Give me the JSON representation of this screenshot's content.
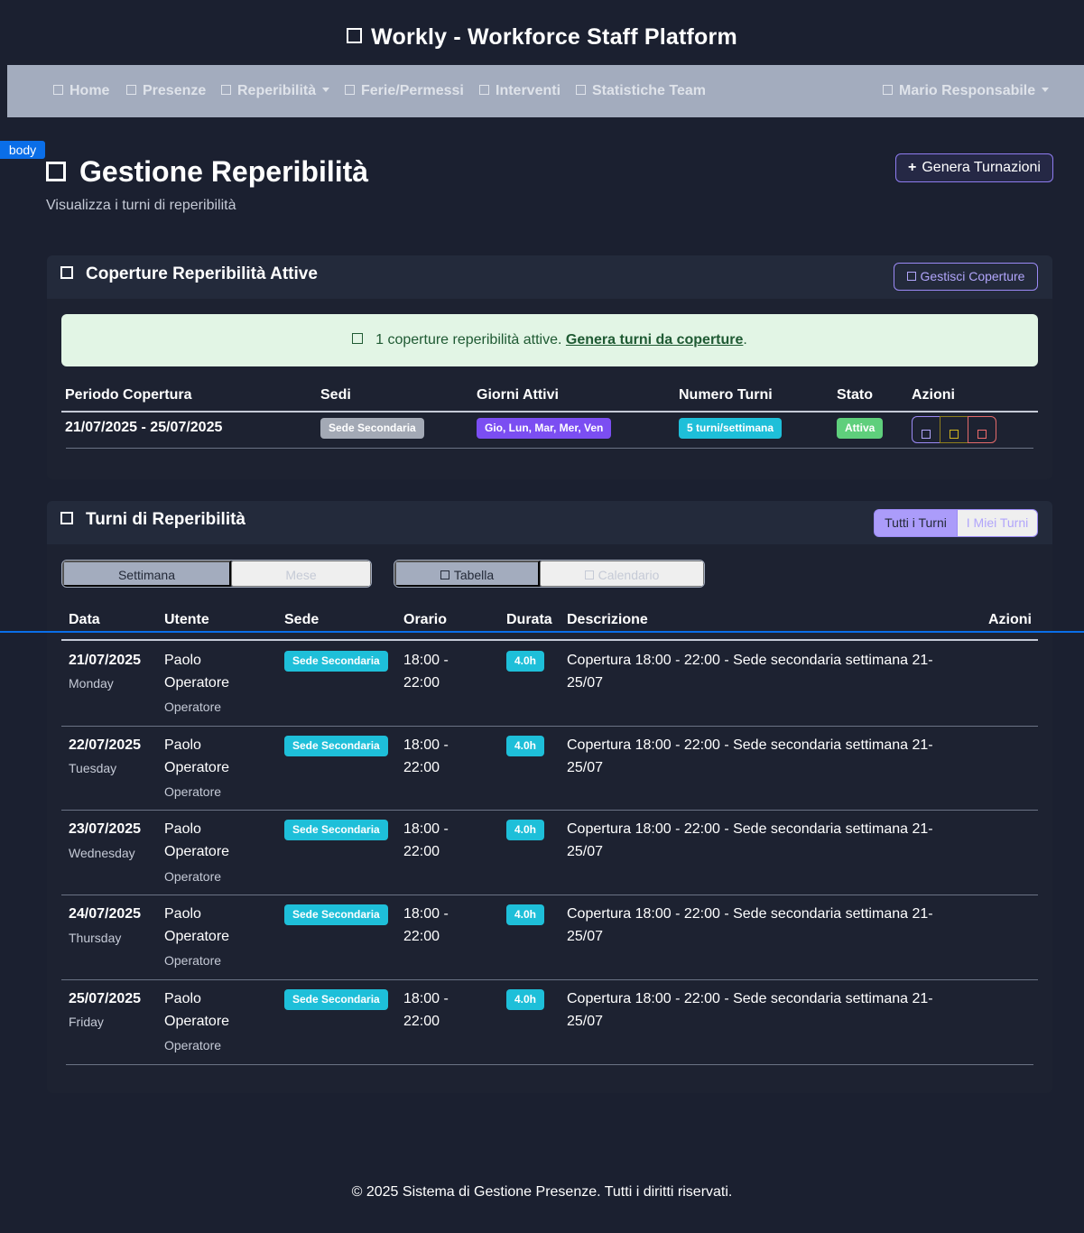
{
  "app": {
    "title": "Workly - Workforce Staff Platform"
  },
  "nav": {
    "items": [
      {
        "label": "Home"
      },
      {
        "label": "Presenze"
      },
      {
        "label": "Reperibilità"
      },
      {
        "label": "Ferie/Permessi"
      },
      {
        "label": "Interventi"
      },
      {
        "label": "Statistiche Team"
      }
    ],
    "user": "Mario Responsabile"
  },
  "devtools": {
    "body_tag": "body"
  },
  "page": {
    "title": "Gestione Reperibilità",
    "subtitle": "Visualizza i turni di reperibilità",
    "generate_button": "Genera Turnazioni"
  },
  "coverage": {
    "title": "Coperture Reperibilità Attive",
    "manage_button": "Gestisci Coperture",
    "alert_text": "1 coperture reperibilità attive.",
    "alert_link": "Genera turni da coperture",
    "alert_end": ".",
    "headers": [
      "Periodo Copertura",
      "Sedi",
      "Giorni Attivi",
      "Numero Turni",
      "Stato",
      "Azioni"
    ],
    "row": {
      "period": "21/07/2025 - 25/07/2025",
      "site": "Sede Secondaria",
      "days": "Gio, Lun, Mar, Mer, Ven",
      "shifts": "5 turni/settimana",
      "status": "Attiva"
    }
  },
  "shifts": {
    "title": "Turni di Reperibilità",
    "filter_all": "Tutti i Turni",
    "filter_mine": "I Miei Turni",
    "period_week": "Settimana",
    "period_month": "Mese",
    "view_table": "Tabella",
    "view_calendar": "Calendario",
    "headers": [
      "Data",
      "Utente",
      "Sede",
      "Orario",
      "Durata",
      "Descrizione",
      "Azioni"
    ],
    "rows": [
      {
        "date": "21/07/2025",
        "day": "Monday",
        "user": "Paolo Operatore",
        "role": "Operatore",
        "site": "Sede Secondaria",
        "time": "18:00 - 22:00",
        "duration": "4.0h",
        "description": "Copertura 18:00 - 22:00 - Sede secondaria settimana 21-25/07"
      },
      {
        "date": "22/07/2025",
        "day": "Tuesday",
        "user": "Paolo Operatore",
        "role": "Operatore",
        "site": "Sede Secondaria",
        "time": "18:00 - 22:00",
        "duration": "4.0h",
        "description": "Copertura 18:00 - 22:00 - Sede secondaria settimana 21-25/07"
      },
      {
        "date": "23/07/2025",
        "day": "Wednesday",
        "user": "Paolo Operatore",
        "role": "Operatore",
        "site": "Sede Secondaria",
        "time": "18:00 - 22:00",
        "duration": "4.0h",
        "description": "Copertura 18:00 - 22:00 - Sede secondaria settimana 21-25/07"
      },
      {
        "date": "24/07/2025",
        "day": "Thursday",
        "user": "Paolo Operatore",
        "role": "Operatore",
        "site": "Sede Secondaria",
        "time": "18:00 - 22:00",
        "duration": "4.0h",
        "description": "Copertura 18:00 - 22:00 - Sede secondaria settimana 21-25/07"
      },
      {
        "date": "25/07/2025",
        "day": "Friday",
        "user": "Paolo Operatore",
        "role": "Operatore",
        "site": "Sede Secondaria",
        "time": "18:00 - 22:00",
        "duration": "4.0h",
        "description": "Copertura 18:00 - 22:00 - Sede secondaria settimana 21-25/07"
      }
    ]
  },
  "footer": {
    "text": "© 2025 Sistema di Gestione Presenze. Tutti i diritti riservati."
  },
  "colors": {
    "background": "#1b2030",
    "navbar": "#a3acbe",
    "accent_purple": "#9b8af5",
    "badge_cyan": "#1ebfd9",
    "badge_green": "#5fcf7c",
    "badge_violet": "#7b4ef2",
    "alert_bg": "#e2f5e5"
  }
}
